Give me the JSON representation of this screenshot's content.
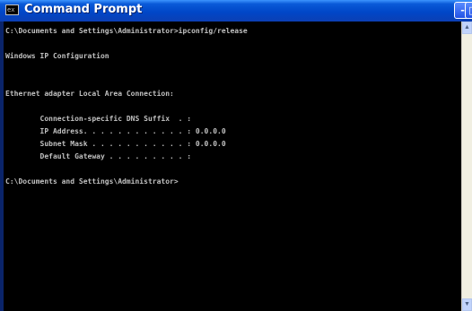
{
  "window": {
    "title": "Command Prompt",
    "icon_label": "ex",
    "minimize_glyph": "-",
    "maximize_glyph": "□"
  },
  "console": {
    "lines": [
      "C:\\Documents and Settings\\Administrator>ipconfig/release",
      "",
      "Windows IP Configuration",
      "",
      "",
      "Ethernet adapter Local Area Connection:",
      "",
      "        Connection-specific DNS Suffix  . :",
      "        IP Address. . . . . . . . . . . . : 0.0.0.0",
      "        Subnet Mask . . . . . . . . . . . : 0.0.0.0",
      "        Default Gateway . . . . . . . . . :",
      "",
      "C:\\Documents and Settings\\Administrator>"
    ]
  },
  "scrollbar": {
    "up_glyph": "▲",
    "down_glyph": "▼"
  }
}
